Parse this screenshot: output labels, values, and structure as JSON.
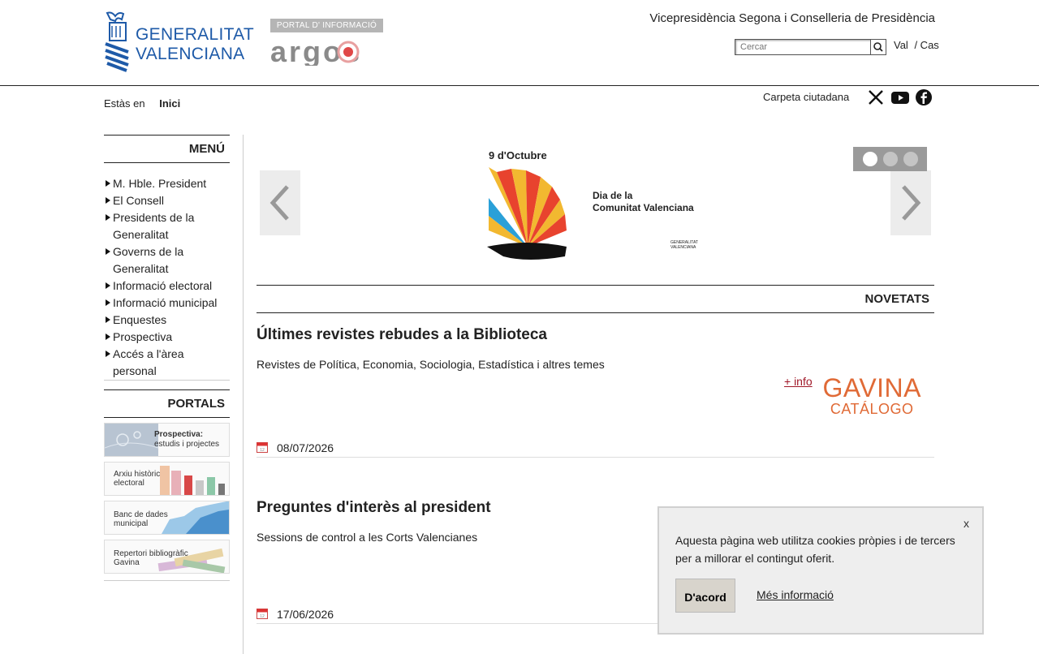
{
  "header": {
    "logo_text_line1": "GENERALITAT",
    "logo_text_line2": "VALENCIANA",
    "portal_tag": "PORTAL D' INFORMACIÓ",
    "portal_name": "argos",
    "department": "Vicepresidència Segona i Conselleria de Presidència",
    "search_placeholder": "Cercar",
    "languages": [
      "Val",
      "/ Cas"
    ]
  },
  "breadcrumb": {
    "prefix": "Estàs en",
    "current": "Inici"
  },
  "topbar": {
    "carpeta": "Carpeta ciutadana",
    "social_icons": [
      "x-icon",
      "youtube-icon",
      "facebook-icon"
    ]
  },
  "sidebar": {
    "menu_title": "MENÚ",
    "menu_items": [
      "M. Hble. President",
      "El Consell",
      "Presidents de la Generalitat",
      "Governs de la Generalitat",
      "Informació electoral",
      "Informació municipal",
      "Enquestes",
      "Prospectiva",
      "Accés a l'àrea personal"
    ],
    "portals_title": "PORTALS",
    "portals": [
      {
        "line1": "Prospectiva:",
        "line2": "estudis i projectes"
      },
      {
        "line1": "Arxiu històric",
        "line2": "electoral"
      },
      {
        "line1": "Banc de dades",
        "line2": "municipal"
      },
      {
        "line1": "Repertori bibliogràfic",
        "line2": "Gavina"
      }
    ]
  },
  "carousel": {
    "slide_date": "9 d'Octubre",
    "slide_title_line1": "Dia de la",
    "slide_title_line2": "Comunitat Valenciana",
    "slide_logo_line1": "GENERALITAT",
    "slide_logo_line2": "VALENCIANA",
    "dots": 3,
    "active_dot": 1
  },
  "news": {
    "section_title": "NOVETATS",
    "items": [
      {
        "title": "Últimes revistes rebudes a la Biblioteca",
        "summary": "Revistes de Política, Economia, Sociologia, Estadística i altres temes",
        "more": "+ info",
        "logo_line1": "GAVINA",
        "logo_line2": "CATÁLOGO",
        "date": "08/07/2026"
      },
      {
        "title": "Preguntes d'interès al president",
        "summary": "Sessions de control a les Corts Valencianes",
        "date": "17/06/2026"
      }
    ]
  },
  "cookie": {
    "close": "x",
    "message": "Aquesta pàgina web utilitza cookies pròpies i de tercers per a millorar el contingut oferit.",
    "accept": "D'acord",
    "more": "Més informació"
  },
  "colors": {
    "brand_blue": "#1e5aa8",
    "gavina_orange": "#e06a36",
    "link_red": "#a01828"
  }
}
